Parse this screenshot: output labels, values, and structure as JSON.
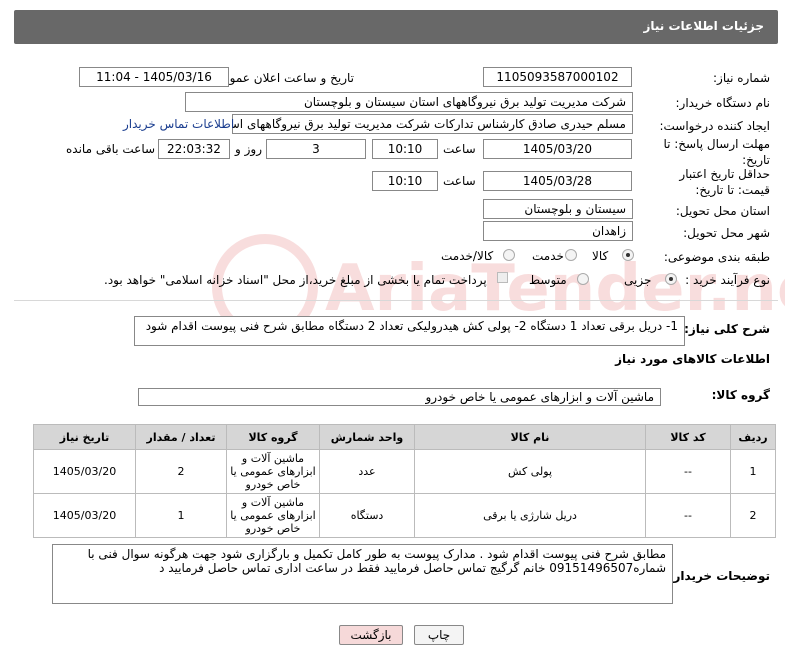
{
  "header": {
    "title": "جزئیات اطلاعات نیاز"
  },
  "fields": {
    "need_number_label": "شماره نیاز:",
    "need_number": "1105093587000102",
    "announce_label": "تاریخ و ساعت اعلان عمومی:",
    "announce_value": "1405/03/16 - 11:04",
    "buyer_org_label": "نام دستگاه خریدار:",
    "buyer_org": "شرکت مدیریت تولید برق نیروگاههای استان سیستان و بلوچستان",
    "creator_label": "ایجاد کننده درخواست:",
    "creator": "مسلم حیدری صادق کارشناس تدارکات شرکت مدیریت تولید برق نیروگاههای اس",
    "contact_link": "اطلاعات تماس خریدار",
    "send_deadline_label": "مهلت ارسال پاسخ: تا تاریخ:",
    "send_date": "1405/03/20",
    "time_word": "ساعت",
    "send_time": "10:10",
    "days": "3",
    "day_and": "روز و",
    "remaining_time": "22:03:32",
    "remaining_label": "ساعت باقی مانده",
    "validity_label": "حداقل تاریخ اعتبار قیمت: تا تاریخ:",
    "validity_date": "1405/03/28",
    "validity_time": "10:10",
    "province_label": "استان محل تحویل:",
    "province": "سیستان و بلوچستان",
    "city_label": "شهر محل تحویل:",
    "city": "زاهدان",
    "category_label": "طبقه بندی موضوعی:",
    "category_options": [
      "کالا",
      "خدمت",
      "کالا/خدمت"
    ],
    "purchase_type_label": "نوع فرآیند خرید :",
    "purchase_options": [
      "جزیی",
      "متوسط"
    ],
    "payment_note": "پرداخت تمام یا بخشی از مبلغ خرید،از محل \"اسناد خزانه اسلامی\" خواهد بود.",
    "description_label": "شرح کلی نیاز:",
    "description": "1- دریل برقی تعداد 1 دستگاه  2- پولی کش هیدرولیکی تعداد 2 دستگاه  مطابق شرح فنی پیوست اقدام شود",
    "goods_info_title": "اطلاعات کالاهای مورد نیاز",
    "goods_group_label": "گروه کالا:",
    "goods_group": "ماشین آلات و ابزارهای عمومی یا خاص خودرو",
    "buyer_notes_label": "توضیحات خریدار:",
    "buyer_notes": "مطابق شرح فنی پیوست اقدام شود . مدارک پیوست به طور کامل تکمیل و بارگزاری شود جهت هرگونه سوال فنی با شماره09151496507  خانم گرگیج تماس حاصل فرمایید  فقط در ساعت اداری تماس حاصل فرمایید د"
  },
  "table": {
    "headers": [
      "ردیف",
      "کد کالا",
      "نام کالا",
      "واحد شمارش",
      "گروه کالا",
      "تعداد / مقدار",
      "تاریخ نیاز"
    ],
    "rows": [
      [
        "1",
        "--",
        "پولی کش",
        "عدد",
        "ماشین آلات و ابزارهای عمومی یا خاص خودرو",
        "2",
        "1405/03/20"
      ],
      [
        "2",
        "--",
        "دریل شارژی یا برقی",
        "دستگاه",
        "ماشین آلات و ابزارهای عمومی یا خاص خودرو",
        "1",
        "1405/03/20"
      ]
    ]
  },
  "buttons": {
    "print": "چاپ",
    "back": "بازگشت"
  },
  "watermark": {
    "text": "AriaTender.net"
  },
  "colors": {
    "header_bg": "#686868",
    "table_header_bg": "#d6d6d6",
    "back_button_bg": "#f6d9d9",
    "link": "#1a3d8f"
  }
}
